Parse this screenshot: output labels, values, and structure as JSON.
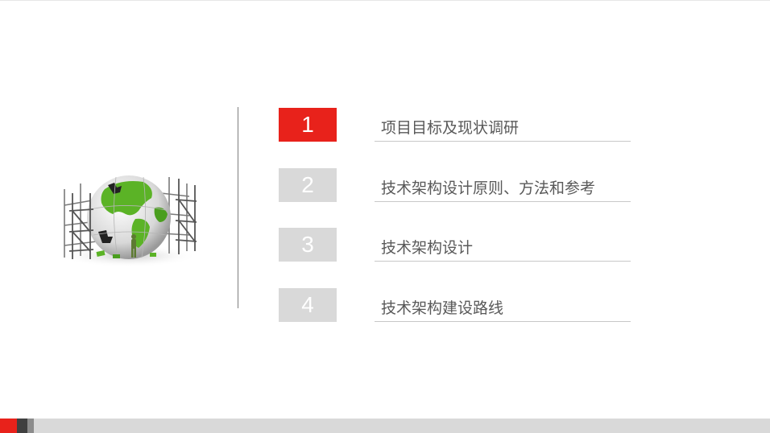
{
  "agenda": {
    "items": [
      {
        "number": "1",
        "label": "项目目标及现状调研"
      },
      {
        "number": "2",
        "label": "技术架构设计原则、方法和参考"
      },
      {
        "number": "3",
        "label": "技术架构设计"
      },
      {
        "number": "4",
        "label": "技术架构建设路线"
      }
    ],
    "active_index": 0
  },
  "colors": {
    "accent": "#e8221b",
    "inactive_box": "#d9d9d9",
    "label_text": "#595959",
    "globe_green": "#5bb326"
  },
  "illustration": {
    "icon": "globe-scaffolding-icon"
  }
}
